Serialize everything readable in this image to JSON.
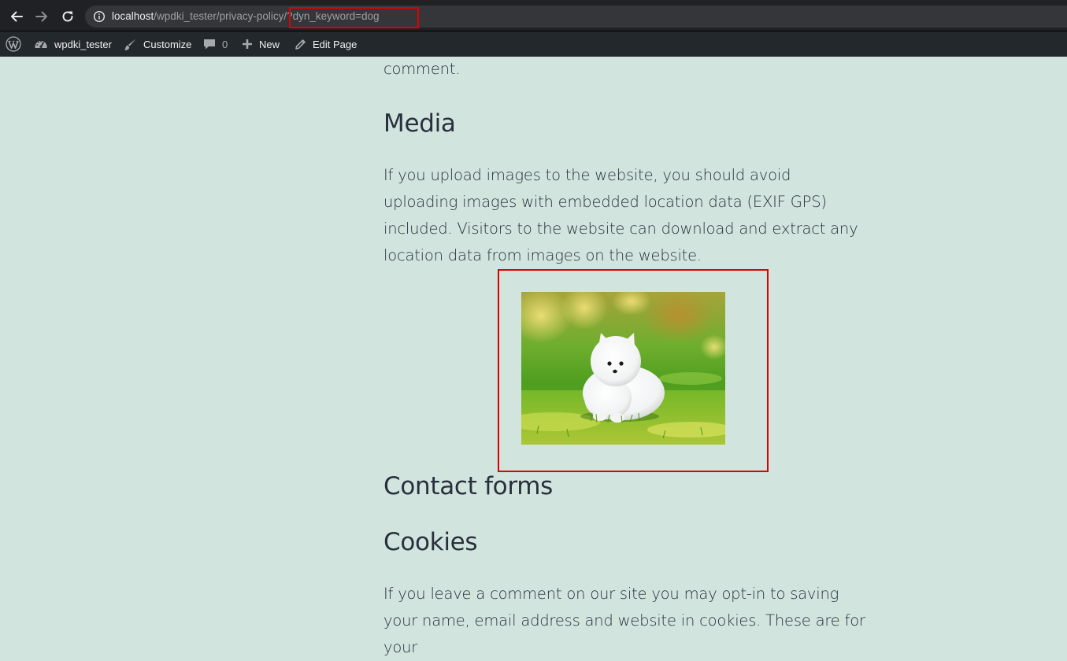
{
  "browser": {
    "url_host": "localhost",
    "url_path": "/wpdki_tester/privacy-policy",
    "url_query": "/?dyn_keyword=dog"
  },
  "admin_bar": {
    "site_name": "wpdki_tester",
    "customize_label": "Customize",
    "comments_count": "0",
    "new_label": "New",
    "edit_page_label": "Edit Page"
  },
  "content": {
    "prev_paragraph_tail": "comment.",
    "media_heading": "Media",
    "media_paragraph": "If you upload images to the website, you should avoid uploading images with embedded location data (EXIF GPS) included. Visitors to the website can download and extract any location data from images on the website.",
    "contact_heading": "Contact forms",
    "cookies_heading": "Cookies",
    "cookies_paragraph": "If you leave a comment on our site you may opt-in to saving your name, email address and website in cookies. These are for your"
  },
  "colors": {
    "page_background": "#d1e4dd",
    "text": "#28303d",
    "admin_bar": "#23282d",
    "highlight": "#e00000"
  },
  "icons": {
    "back": "arrow-left-icon",
    "forward": "arrow-right-icon",
    "reload": "reload-icon",
    "site_info": "info-icon",
    "wordpress": "wordpress-logo-icon",
    "dashboard": "dashboard-icon",
    "customize": "brush-icon",
    "comments": "comment-bubble-icon",
    "new": "plus-icon",
    "edit": "pencil-icon"
  }
}
